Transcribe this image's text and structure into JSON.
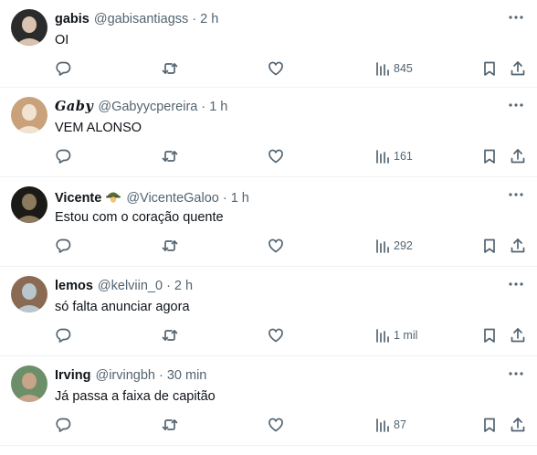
{
  "tweets": [
    {
      "name": "gabis",
      "handle": "@gabisantiagss",
      "time": "2 h",
      "text": "OI",
      "views": "845",
      "avatar_colors": [
        "#2b2b2b",
        "#d9c3b0"
      ],
      "icons": {
        "reply": "reply-icon",
        "retweet": "retweet-icon",
        "like": "heart-icon",
        "views": "views-icon",
        "bookmark": "bookmark-icon",
        "share": "share-icon",
        "more": "more-icon"
      }
    },
    {
      "name": "𝑮𝒂𝒃𝒚",
      "handle": "@Gabyycpereira",
      "time": "1 h",
      "text": "VEM ALONSO",
      "views": "161",
      "avatar_colors": [
        "#c9a27c",
        "#f1e2d2"
      ]
    },
    {
      "name": "Vicente",
      "badge_icon": "soldier-helmet-icon",
      "handle": "@VicenteGaloo",
      "time": "1 h",
      "text": "Estou com o coração quente",
      "views": "292",
      "avatar_colors": [
        "#1c1a17",
        "#8b7a5d"
      ]
    },
    {
      "name": "lemos",
      "handle": "@kelviin_0",
      "time": "2 h",
      "text": "só falta anunciar agora",
      "views": "1 mil",
      "avatar_colors": [
        "#8a6a52",
        "#b9c6cc"
      ]
    },
    {
      "name": "Irving",
      "handle": "@irvingbh",
      "time": "30 min",
      "text": "Já passa a faixa de capitão",
      "views": "87",
      "avatar_colors": [
        "#6c8f6a",
        "#c8a489"
      ]
    }
  ],
  "colors": {
    "text": "#0f1419",
    "secondary": "#536471",
    "divider": "#eff3f4"
  }
}
